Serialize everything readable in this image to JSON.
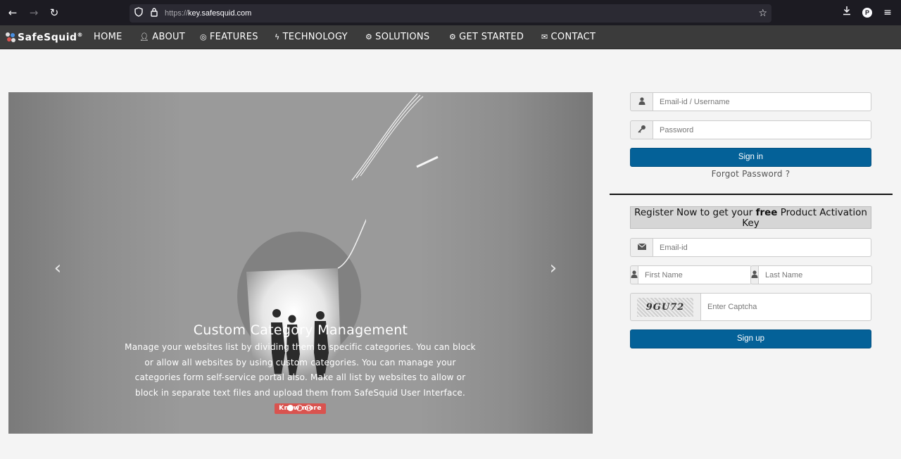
{
  "browser": {
    "url_prefix": "https://",
    "url_host": "key.safesquid.com",
    "profile_initial": "P"
  },
  "site": {
    "logo_text": "SafeSquid",
    "logo_mark": "®",
    "nav": [
      {
        "label": "HOME",
        "icon": ""
      },
      {
        "label": "ABOUT",
        "icon": "user-icon"
      },
      {
        "label": "FEATURES",
        "icon": "bullseye-icon"
      },
      {
        "label": "TECHNOLOGY",
        "icon": "bolt-icon"
      },
      {
        "label": "SOLUTIONS",
        "icon": "cogs-icon"
      },
      {
        "label": "GET STARTED",
        "icon": "cogs-icon"
      },
      {
        "label": "CONTACT",
        "icon": "envelope-icon"
      }
    ]
  },
  "carousel": {
    "title": "Custom Category Management",
    "description": "Manage your websites list by dividing them to specific categories. You can block or allow all websites by using custom categories. You can manage your categories form self-service portal also. Make all list by websites to allow or block in separate text files and upload them from SafeSquid User Interface.",
    "know_more": "Know more",
    "prev": "‹",
    "next": "›",
    "slide_count": 3,
    "active_slide": 1
  },
  "login": {
    "email_placeholder": "Email-id / Username",
    "password_placeholder": "Password",
    "signin_label": "Sign in",
    "forgot_label": "Forgot Password ?"
  },
  "register": {
    "heading_before": "Register Now to get your ",
    "heading_bold": "free",
    "heading_after": " Product Activation Key",
    "email_placeholder": "Email-id",
    "first_name_placeholder": "First Name",
    "last_name_placeholder": "Last Name",
    "captcha_text": "9GU72",
    "captcha_placeholder": "Enter Captcha",
    "signup_label": "Sign up"
  },
  "colors": {
    "primary": "#046198",
    "know_more": "#d9534f",
    "navbar": "#3b3b3b",
    "browser_chrome": "#1c1b22"
  }
}
